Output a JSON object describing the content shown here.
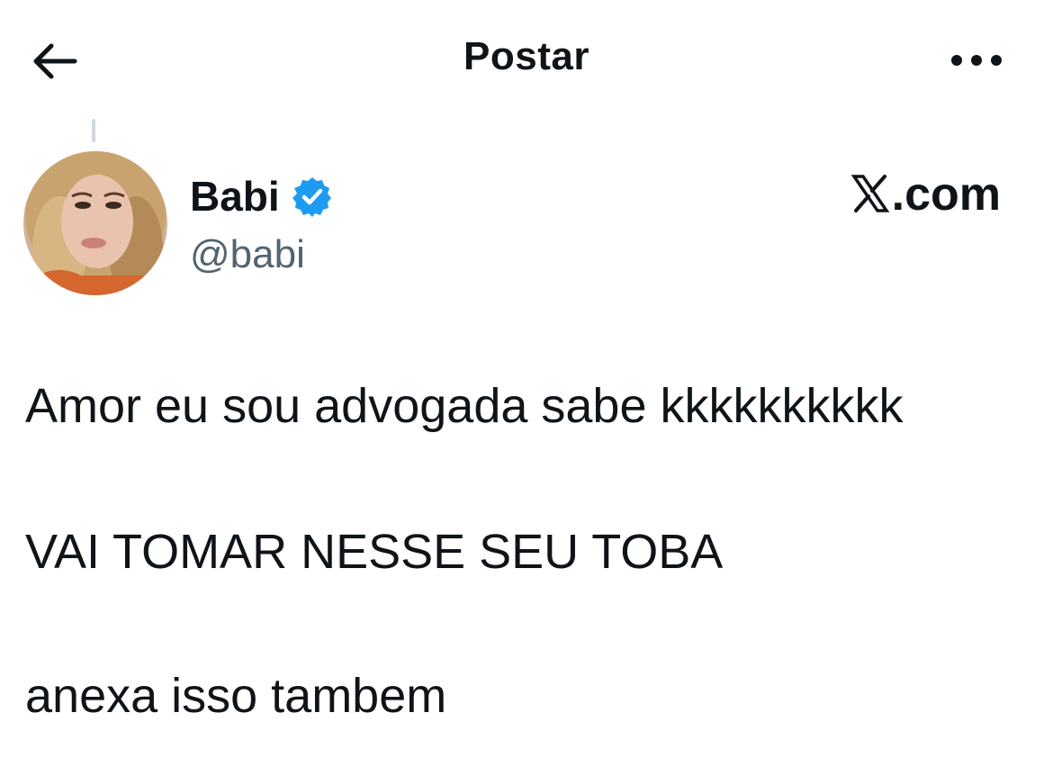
{
  "header": {
    "title": "Postar",
    "back_icon": "arrow-left-icon",
    "more_icon": "more-horizontal-icon"
  },
  "author": {
    "display_name": "Babi",
    "handle": "@babi",
    "verified": true,
    "verified_color": "#1d9bf0"
  },
  "watermark": {
    "text": ".com",
    "logo_icon": "x-logo-icon"
  },
  "tweet": {
    "lines": [
      "Amor eu sou advogada sabe kkkkkkkkkk",
      "VAI TOMAR NESSE SEU TOBA",
      "anexa isso tambem"
    ]
  },
  "colors": {
    "text_primary": "#0f1419",
    "text_secondary": "#536471",
    "accent": "#1d9bf0"
  }
}
